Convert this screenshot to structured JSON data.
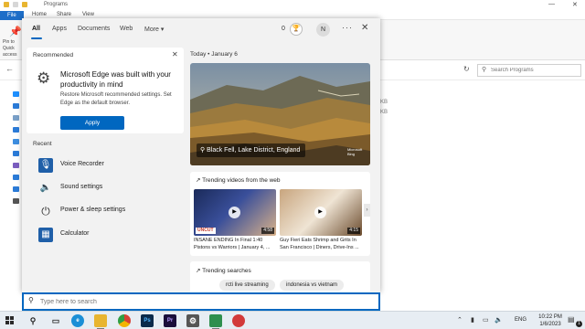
{
  "explorer": {
    "title": "Programs",
    "ribbon_tabs": [
      "File",
      "Home",
      "Share",
      "View"
    ],
    "pin_label": "Pin to Quick access",
    "search_placeholder": "Search Programs",
    "size_unit": "KB",
    "nav_icon_colors": [
      "#1e90ff",
      "#2b7bd8",
      "#7aa0c8",
      "#2b7bd8",
      "#3d8ee0",
      "#2b7bd8",
      "#7b5ec0",
      "#2b7bd8",
      "#2b7bd8",
      "#555"
    ]
  },
  "start_panel": {
    "tabs": [
      "All",
      "Apps",
      "Documents",
      "Web",
      "More"
    ],
    "active_tab": "All",
    "points": "0",
    "avatar_initial": "N",
    "recommended": {
      "heading": "Recommended",
      "title": "Microsoft Edge was built with your productivity in mind",
      "description": "Restore Microsoft recommended settings. Set Edge as the default browser.",
      "action_label": "Apply"
    },
    "recent": {
      "heading": "Recent",
      "items": [
        {
          "label": "Voice Recorder",
          "icon": "microphone-icon",
          "icon_color": "#1f5fa8"
        },
        {
          "label": "Sound settings",
          "icon": "speaker-icon",
          "icon_color": "#333333"
        },
        {
          "label": "Power & sleep settings",
          "icon": "power-icon",
          "icon_color": "#333333"
        },
        {
          "label": "Calculator",
          "icon": "calculator-icon",
          "icon_color": "#1f5fa8"
        }
      ]
    },
    "today": {
      "label": "Today",
      "separator": "•",
      "date": "January 6",
      "hero_caption": "Black Fell, Lake District, England",
      "hero_logo": "Microsoft Bing"
    },
    "trending_videos": {
      "heading": "Trending videos from the web",
      "items": [
        {
          "title": "INSANE ENDING In Final 1:40 Pistons vs Warriors | January 4, ...",
          "line1": "INSANE ENDING In Final 1:40",
          "line2": "Pistons vs Warriors | January 4, ...",
          "duration": "4:58",
          "badge": "UNCUT"
        },
        {
          "title": "Guy Fieri Eats Shrimp and Grits In San Francisco | Diners, Drive-Ins ...",
          "line1": "Guy Fieri Eats Shrimp and Grits In",
          "line2": "San Francisco | Diners, Drive-Ins ...",
          "duration": "4:15"
        }
      ]
    },
    "trending_searches": {
      "heading": "Trending searches",
      "items": [
        "rcti live streaming",
        "indonesia vs vietnam"
      ]
    },
    "search_placeholder": "Type here to search"
  },
  "taskbar": {
    "apps": [
      {
        "name": "task-view",
        "label": "",
        "color": "#444444"
      },
      {
        "name": "edge",
        "label": "e",
        "color": "#1b8fd6"
      },
      {
        "name": "file-explorer",
        "label": "",
        "color": "#e8b530"
      },
      {
        "name": "chrome",
        "label": "",
        "color": "#d64133"
      },
      {
        "name": "photoshop",
        "label": "Ps",
        "color": "#0b2a4a"
      },
      {
        "name": "premiere",
        "label": "Pr",
        "color": "#1a0e3a"
      },
      {
        "name": "settings",
        "label": "",
        "color": "#555555"
      },
      {
        "name": "camtasia",
        "label": "",
        "color": "#2f8f4e"
      },
      {
        "name": "recorder",
        "label": "",
        "color": "#d23a3a"
      }
    ],
    "language": "ENG",
    "time": "10:22 PM",
    "date": "1/6/2023",
    "notification_count": "1"
  }
}
